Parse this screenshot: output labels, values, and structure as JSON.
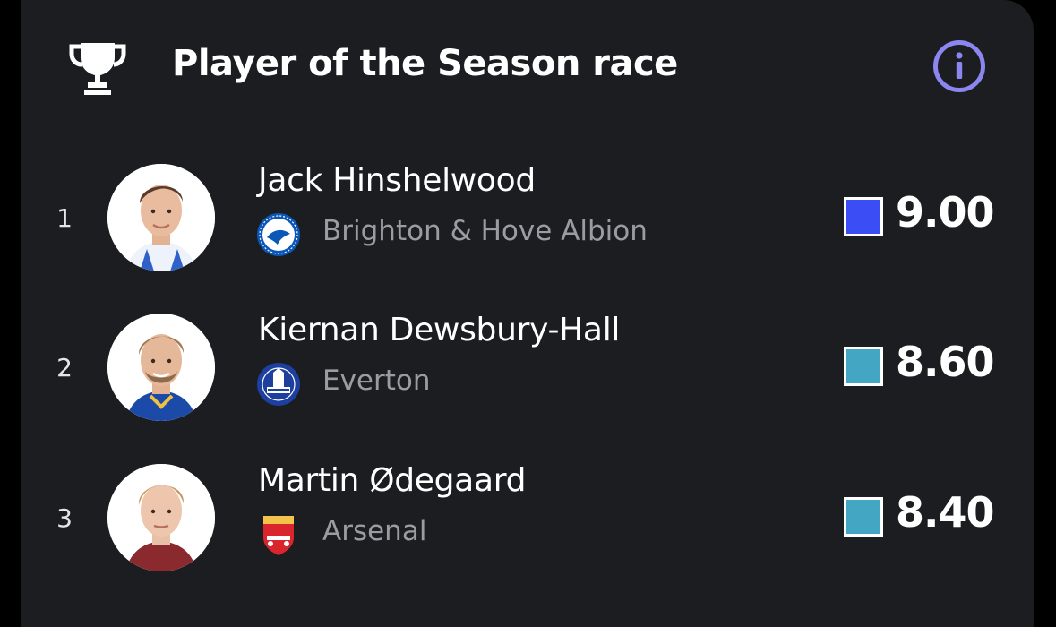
{
  "header": {
    "title": "Player of the Season race",
    "trophy_icon": "trophy-icon",
    "info_icon": "info-icon",
    "info_color": "#8b86f0"
  },
  "players": [
    {
      "rank": "1",
      "name": "Jack Hinshelwood",
      "club": "Brighton & Hove Albion",
      "club_badge": "brighton-crest",
      "rating": "9.00",
      "rating_color": "#3b4ef5"
    },
    {
      "rank": "2",
      "name": "Kiernan Dewsbury-Hall",
      "club": "Everton",
      "club_badge": "everton-crest",
      "rating": "8.60",
      "rating_color": "#43a7c4"
    },
    {
      "rank": "3",
      "name": "Martin Ødegaard",
      "club": "Arsenal",
      "club_badge": "arsenal-crest",
      "rating": "8.40",
      "rating_color": "#43a7c4"
    }
  ],
  "colors": {
    "card_background": "#1b1d21",
    "club_text": "#9a9ca3"
  }
}
